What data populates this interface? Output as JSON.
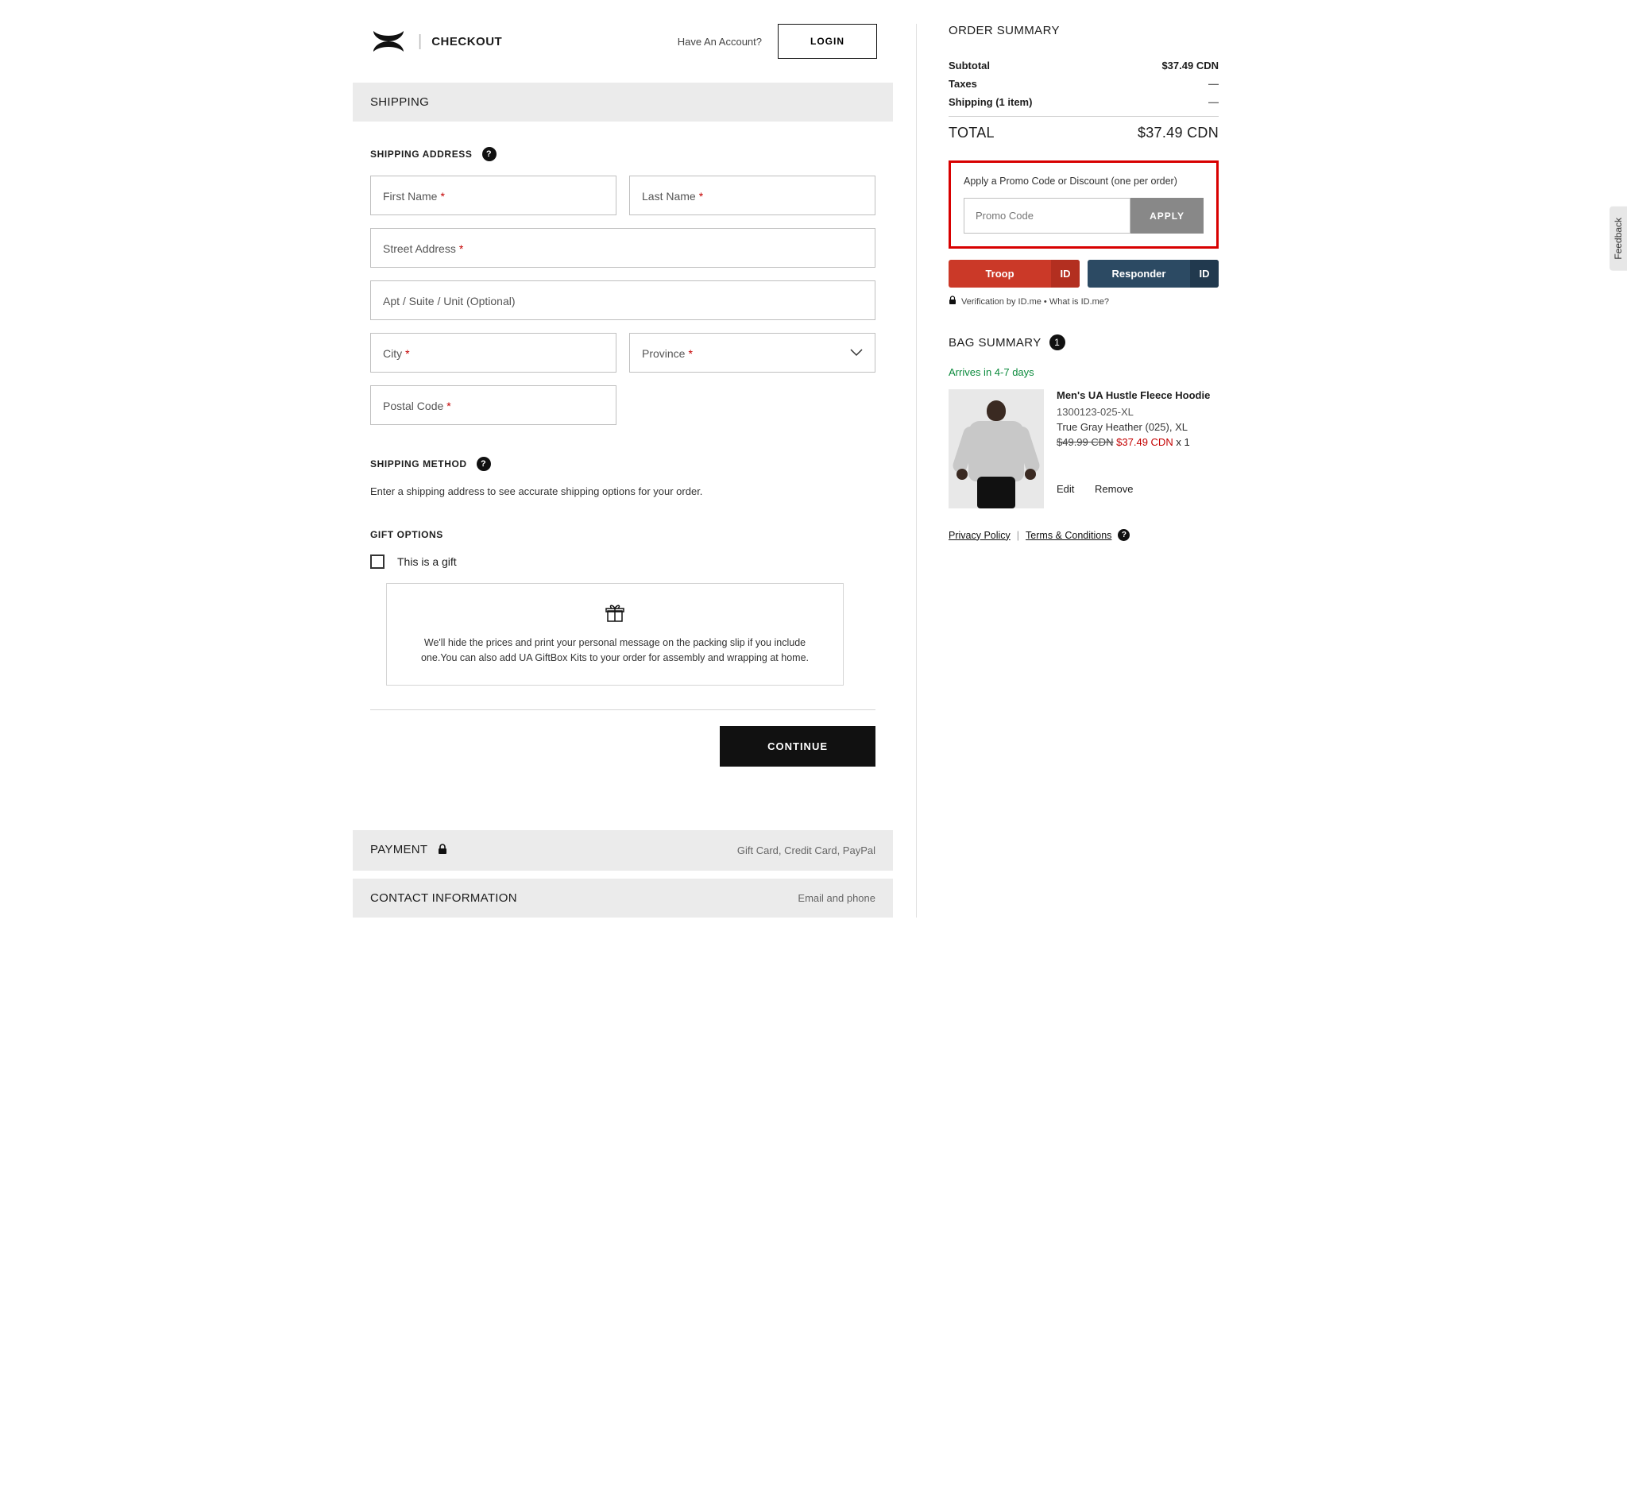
{
  "header": {
    "checkout_label": "CHECKOUT",
    "have_account": "Have An Account?",
    "login_label": "LOGIN"
  },
  "shipping": {
    "title": "SHIPPING",
    "address_heading": "SHIPPING ADDRESS",
    "fields": {
      "first_name": "First Name",
      "last_name": "Last Name",
      "street": "Street Address",
      "apt": "Apt / Suite / Unit (Optional)",
      "city": "City",
      "province": "Province",
      "postal": "Postal Code"
    },
    "method_heading": "SHIPPING METHOD",
    "method_note": "Enter a shipping address to see accurate shipping options for your order."
  },
  "gift": {
    "heading": "GIFT OPTIONS",
    "checkbox_label": "This is a gift",
    "panel_text": "We'll hide the prices and print your personal message on the packing slip if you include one.You can also add UA GiftBox Kits to your order for assembly and wrapping at home."
  },
  "continue_label": "CONTINUE",
  "payment": {
    "title": "PAYMENT",
    "hint": "Gift Card, Credit Card, PayPal"
  },
  "contact": {
    "title": "CONTACT INFORMATION",
    "hint": "Email and phone"
  },
  "order_summary": {
    "title": "ORDER SUMMARY",
    "rows": {
      "subtotal_label": "Subtotal",
      "subtotal_value": "$37.49 CDN",
      "taxes_label": "Taxes",
      "taxes_value": "—",
      "shipping_label": "Shipping (1 item)",
      "shipping_value": "—"
    },
    "total_label": "TOTAL",
    "total_value": "$37.49 CDN"
  },
  "promo": {
    "heading": "Apply a Promo Code or Discount (one per order)",
    "placeholder": "Promo Code",
    "apply_label": "APPLY"
  },
  "idme": {
    "troop": "Troop",
    "responder": "Responder",
    "tag": "ID",
    "verify_text": "Verification by ID.me • What is ID.me?"
  },
  "bag": {
    "title": "BAG SUMMARY",
    "count": "1",
    "arrive": "Arrives in 4-7 days",
    "item": {
      "name": "Men's UA Hustle Fleece Hoodie",
      "sku": "1300123-025-XL",
      "color": "True Gray Heather (025), XL",
      "orig_price": "$49.99 CDN",
      "sale_price": "$37.49 CDN",
      "qty": "x 1",
      "edit": "Edit",
      "remove": "Remove"
    }
  },
  "policy": {
    "privacy": "Privacy Policy",
    "terms": "Terms & Conditions"
  },
  "feedback_tab": "Feedback"
}
